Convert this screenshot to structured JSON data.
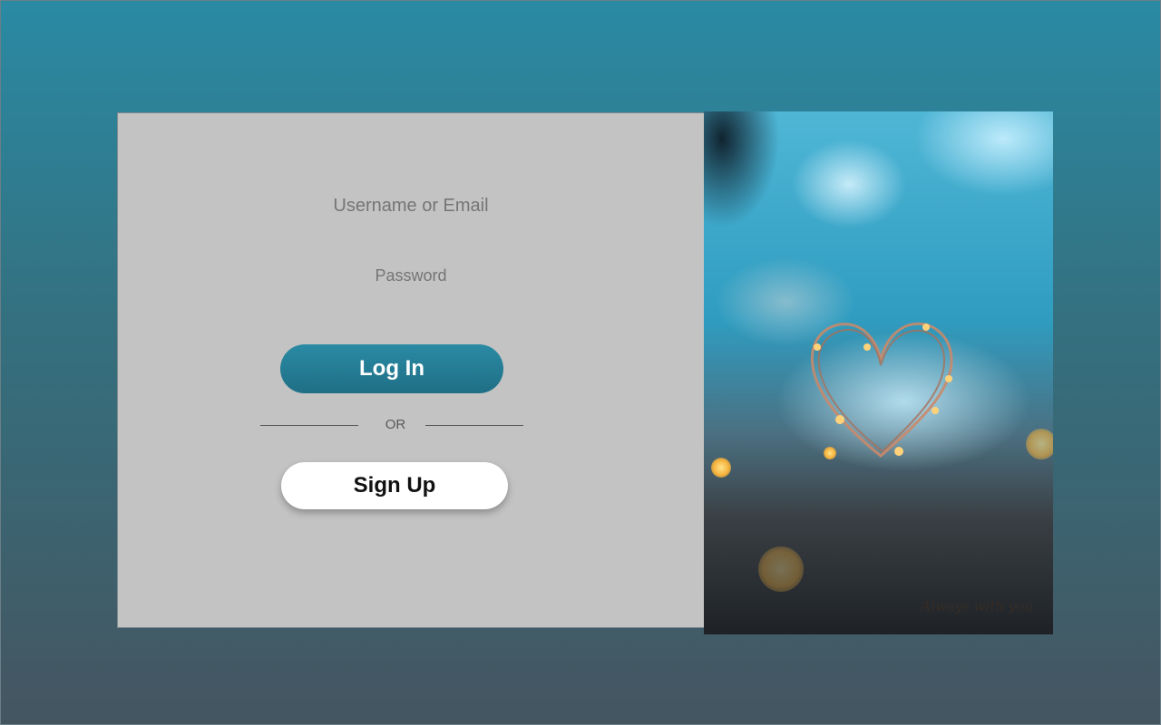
{
  "form": {
    "username_placeholder": "Username or Email",
    "password_placeholder": "Password",
    "login_label": "Log In",
    "divider_text": "OR",
    "signup_label": "Sign Up"
  },
  "photo": {
    "caption": "Always with you",
    "icon": "heart-icon"
  },
  "colors": {
    "accent": "#2a8aa4",
    "panel": "#c2c3c2",
    "label_text": "#7a4410"
  }
}
